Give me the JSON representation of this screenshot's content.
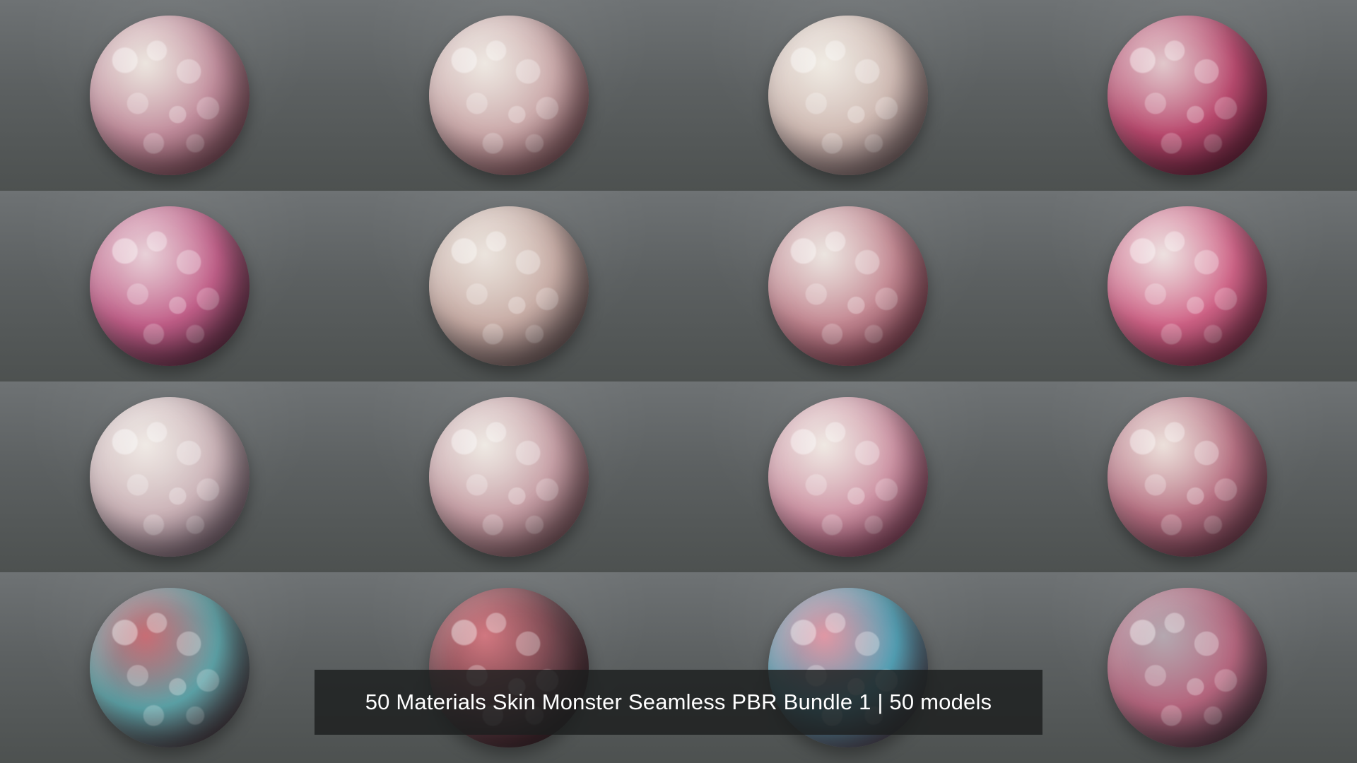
{
  "caption": "50 Materials Skin Monster Seamless PBR Bundle 1 | 50 models",
  "previews": [
    {
      "colors": [
        "#e7ded6",
        "#c08a9a",
        "#9b5567"
      ]
    },
    {
      "colors": [
        "#e9e2da",
        "#c9a6a7",
        "#a05a67"
      ]
    },
    {
      "colors": [
        "#ece6dd",
        "#cdb7b0",
        "#8c6d74"
      ]
    },
    {
      "colors": [
        "#d9b8bd",
        "#b8456b",
        "#7e2a49"
      ]
    },
    {
      "colors": [
        "#e2c4cd",
        "#c05b86",
        "#6e3551"
      ]
    },
    {
      "colors": [
        "#e6ddd4",
        "#c6aaa3",
        "#7b6165"
      ]
    },
    {
      "colors": [
        "#e7ded8",
        "#c2848f",
        "#a23f5a"
      ]
    },
    {
      "colors": [
        "#e8d9d8",
        "#cf5f84",
        "#9a3658"
      ]
    },
    {
      "colors": [
        "#ebe4de",
        "#c9b0b5",
        "#8a6d84"
      ]
    },
    {
      "colors": [
        "#eae4dd",
        "#c59ca3",
        "#96606c"
      ]
    },
    {
      "colors": [
        "#ebe3dc",
        "#cc8fa1",
        "#a7406a"
      ]
    },
    {
      "colors": [
        "#e7d8d1",
        "#b56c7f",
        "#8d4861"
      ]
    },
    {
      "colors": [
        "#b8454f",
        "#5aa2a7",
        "#6a2431"
      ]
    },
    {
      "colors": [
        "#c4525d",
        "#6b4048",
        "#3f2a33"
      ]
    },
    {
      "colors": [
        "#d77b8c",
        "#4fa0b6",
        "#7b3648"
      ]
    },
    {
      "colors": [
        "#a0909a",
        "#b5637c",
        "#4e4250"
      ]
    }
  ]
}
